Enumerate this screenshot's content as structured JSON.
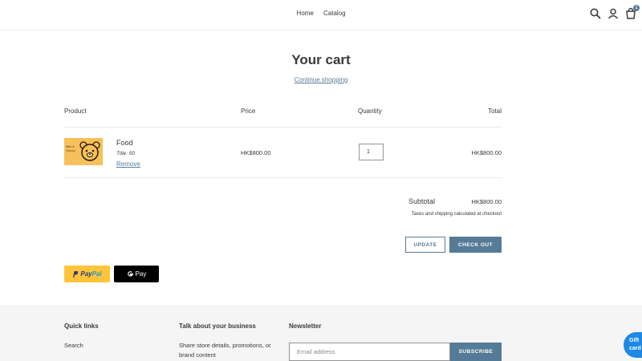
{
  "header": {
    "nav": [
      "Home",
      "Catalog"
    ],
    "cart_count": "1"
  },
  "cart": {
    "title": "Your cart",
    "continue_label": "Continue shopping",
    "columns": {
      "product": "Product",
      "price": "Price",
      "quantity": "Quantity",
      "total": "Total"
    },
    "item": {
      "name": "Food",
      "variant": "Title: 50",
      "remove_label": "Remove",
      "price": "HK$800.00",
      "quantity": "1",
      "total": "HK$800.00",
      "thumb_text": "Milk & Honey"
    },
    "subtotal_label": "Subtotal",
    "subtotal_value": "HK$800.00",
    "tax_note": "Taxes and shipping calculated at checkout",
    "update_label": "UPDATE",
    "checkout_label": "CHECK OUT"
  },
  "payments": {
    "paypal_a": "Pay",
    "paypal_b": "Pal",
    "gpay_label": "Pay"
  },
  "footer": {
    "quick_links_heading": "Quick links",
    "quick_link_search": "Search",
    "talk_heading": "Talk about your business",
    "talk_text": "Share store details, promotions, or brand content",
    "newsletter_heading": "Newsletter",
    "email_placeholder": "Email address",
    "subscribe_label": "SUBSCRIBE"
  },
  "gift_label": "Gift card",
  "colors": {
    "accent": "#557b97",
    "paypal_yellow": "#ffc439",
    "gift_blue": "#1e88e5"
  }
}
